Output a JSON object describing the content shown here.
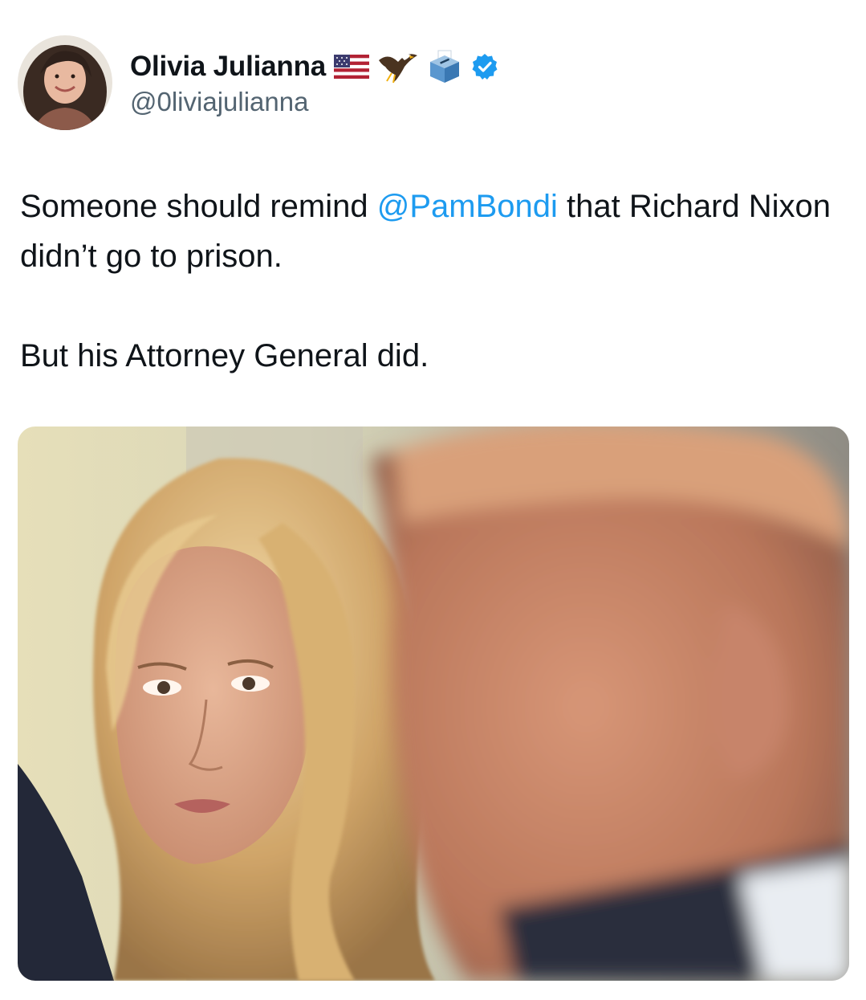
{
  "author": {
    "display_name": "Olivia Julianna",
    "handle": "@0liviajulianna",
    "badges": [
      "us-flag-icon",
      "eagle-icon",
      "ballot-box-icon",
      "verified-badge-icon"
    ],
    "verified_color": "#1d9bf0"
  },
  "post": {
    "text_before_mention": "Someone should remind ",
    "mention": "@PamBondi",
    "text_after_mention": " that Richard Nixon didn’t go to prison.",
    "second_paragraph": "But his Attorney General did."
  },
  "colors": {
    "text": "#0f1419",
    "secondary": "#536471",
    "link": "#1d9bf0"
  }
}
